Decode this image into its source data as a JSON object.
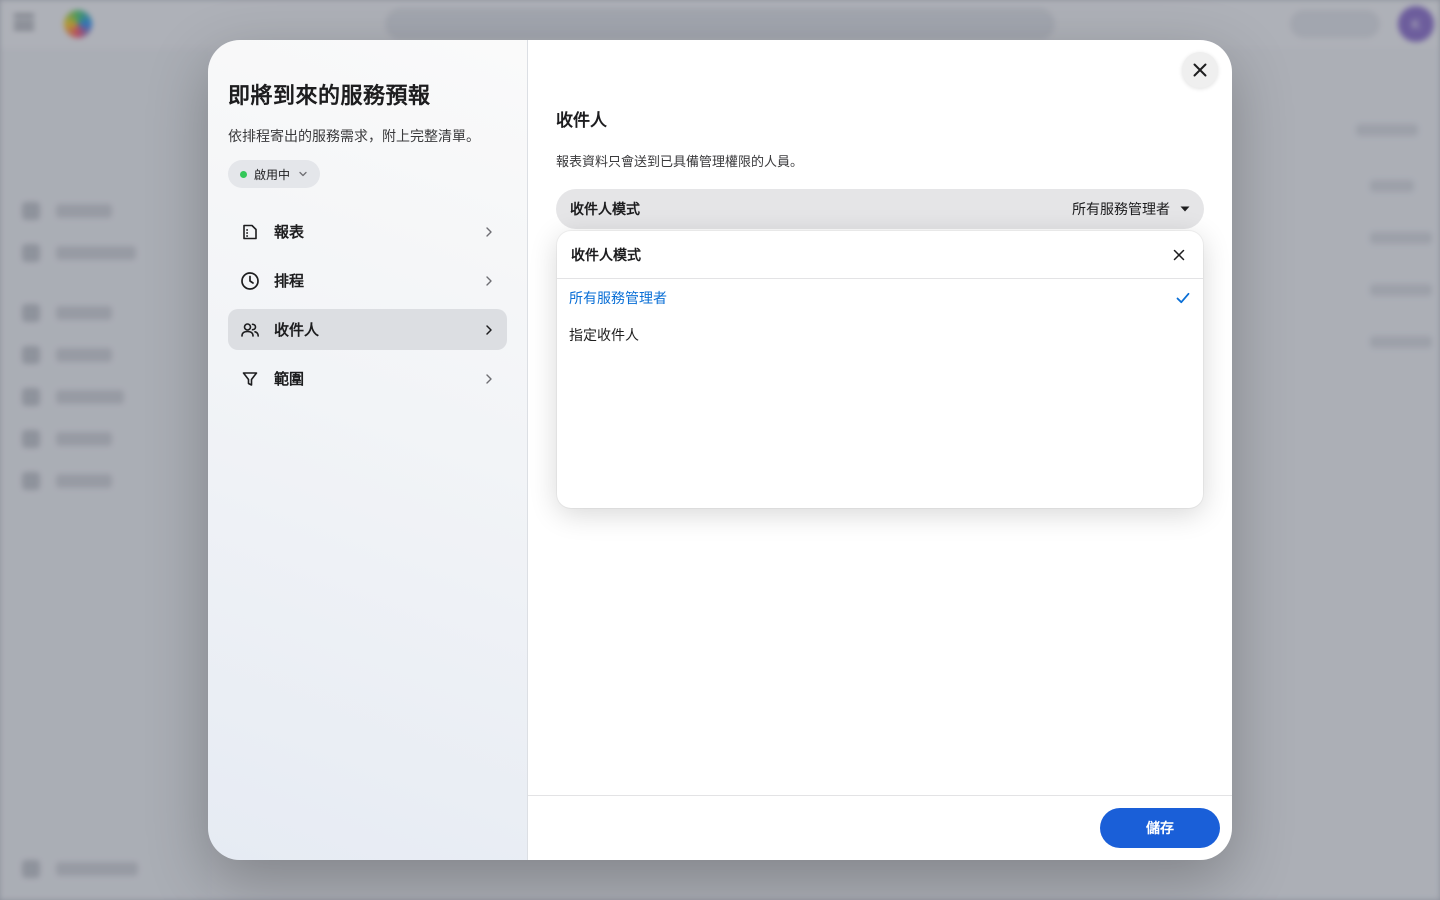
{
  "background": {
    "avatar_initial": "K"
  },
  "modal": {
    "title": "即將到來的服務預報",
    "subtitle": "依排程寄出的服務需求，附上完整清單。",
    "status": {
      "label": "啟用中",
      "dot_color": "#34c759"
    },
    "nav": {
      "items": [
        {
          "label": "報表",
          "icon": "document-icon",
          "active": false
        },
        {
          "label": "排程",
          "icon": "clock-icon",
          "active": false
        },
        {
          "label": "收件人",
          "icon": "people-icon",
          "active": true
        },
        {
          "label": "範圍",
          "icon": "filter-icon",
          "active": false
        }
      ]
    },
    "content": {
      "section_title": "收件人",
      "section_description": "報表資料只會送到已具備管理權限的人員。",
      "select": {
        "label": "收件人模式",
        "value": "所有服務管理者"
      },
      "dropdown": {
        "title": "收件人模式",
        "options": [
          {
            "label": "所有服務管理者",
            "selected": true
          },
          {
            "label": "指定收件人",
            "selected": false
          }
        ]
      }
    },
    "footer": {
      "save_label": "儲存"
    }
  },
  "colors": {
    "accent": "#1a5fd8",
    "selected_text": "#0a6fd6",
    "status_active": "#34c759"
  }
}
